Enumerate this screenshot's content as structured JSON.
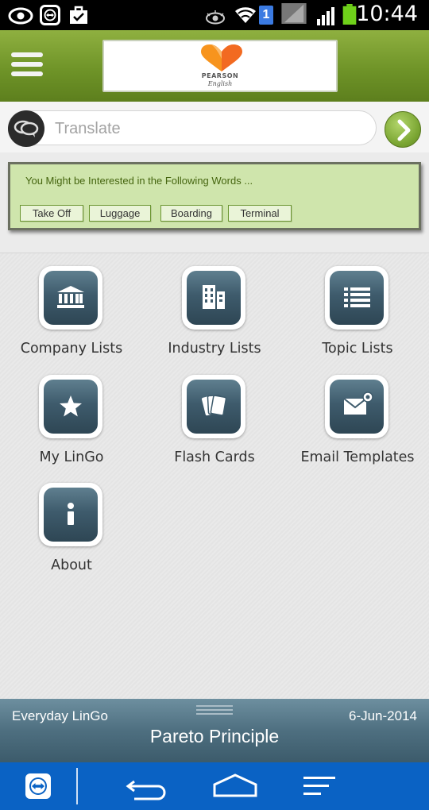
{
  "status_bar": {
    "time": "10:44",
    "sim_badge": "1",
    "icons": [
      "eye-icon",
      "teamviewer-icon",
      "briefcase-icon",
      "eye-icon",
      "wifi-icon",
      "sim-icon",
      "signal-icon",
      "battery-icon"
    ]
  },
  "header": {
    "logo_text": "PEARSON",
    "logo_sub": "English",
    "accent": "#6f9428"
  },
  "translate": {
    "placeholder": "Translate"
  },
  "suggestions": {
    "title": "You Might be Interested in the Following Words ...",
    "words": [
      "Take Off",
      "Luggage",
      "Boarding",
      "Terminal"
    ]
  },
  "menu": {
    "items": [
      {
        "label": "Company Lists",
        "icon": "bank-icon"
      },
      {
        "label": "Industry Lists",
        "icon": "building-icon"
      },
      {
        "label": "Topic Lists",
        "icon": "list-icon"
      },
      {
        "label": "My LinGo",
        "icon": "star-icon"
      },
      {
        "label": "Flash Cards",
        "icon": "cards-icon"
      },
      {
        "label": "Email Templates",
        "icon": "email-icon"
      },
      {
        "label": "About",
        "icon": "info-icon"
      }
    ]
  },
  "footer": {
    "app_name": "Everyday LinGo",
    "date": "6-Jun-2014",
    "phrase": "Pareto Principle"
  },
  "nav": {
    "icons": [
      "teamviewer-icon",
      "back-icon",
      "home-icon",
      "recent-apps-icon"
    ],
    "color": "#0a62c4"
  }
}
